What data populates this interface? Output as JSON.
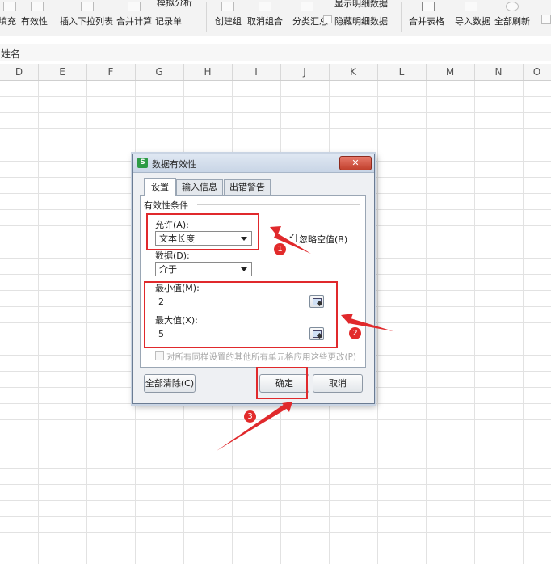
{
  "ribbon": {
    "items": [
      "填充",
      "有效性",
      "插入下拉列表",
      "合并计算",
      "记录单",
      "模拟分析",
      "创建组",
      "取消组合",
      "分类汇总",
      "显示明细数据",
      "隐藏明细数据",
      "合并表格",
      "导入数据",
      "全部刷新"
    ],
    "dropdown_mark": "▾"
  },
  "formula_bar": {
    "cell_content": "姓名"
  },
  "columns": [
    "D",
    "E",
    "F",
    "G",
    "H",
    "I",
    "J",
    "K",
    "L",
    "M",
    "N",
    "O"
  ],
  "dialog": {
    "title": "数据有效性",
    "app_icon": "S",
    "close_label": "✕",
    "tabs": [
      "设置",
      "输入信息",
      "出错警告"
    ],
    "group_title": "有效性条件",
    "allow_label": "允许(A):",
    "allow_value": "文本长度",
    "ignore_blank_label": "忽略空值(B)",
    "ignore_blank_checked": true,
    "data_label": "数据(D):",
    "data_value": "介于",
    "min_label": "最小值(M):",
    "min_value": "2",
    "max_label": "最大值(X):",
    "max_value": "5",
    "apply_all_label": "对所有同样设置的其他所有单元格应用这些更改(P)",
    "clear_all_label": "全部清除(C)",
    "ok_label": "确定",
    "cancel_label": "取消"
  },
  "annotations": {
    "badges": [
      "1",
      "2",
      "3"
    ],
    "highlight_color": "#e0292c"
  }
}
